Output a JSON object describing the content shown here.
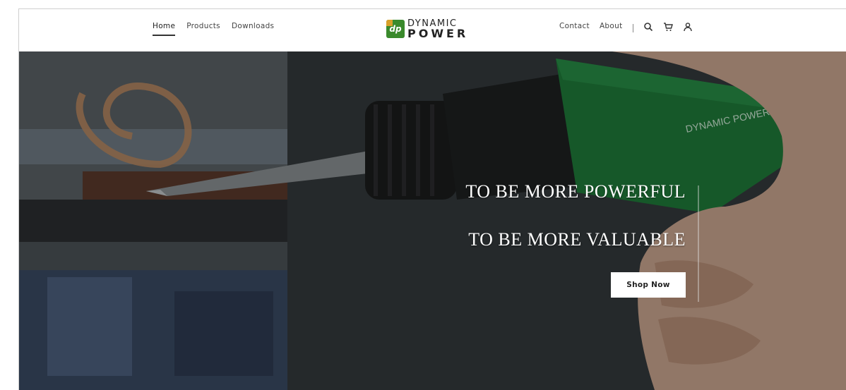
{
  "nav": {
    "left": [
      {
        "label": "Home",
        "active": true
      },
      {
        "label": "Products",
        "active": false
      },
      {
        "label": "Downloads",
        "active": false
      }
    ],
    "right": [
      {
        "label": "Contact"
      },
      {
        "label": "About"
      }
    ],
    "icons": [
      "search-icon",
      "cart-icon",
      "user-icon"
    ]
  },
  "logo": {
    "mark": "dp",
    "top": "DYNAMIC",
    "bottom": "POWER",
    "colors": {
      "green": "#3a8a2c",
      "gold": "#d8a02a"
    }
  },
  "hero": {
    "line1": "TO BE MORE POWERFUL",
    "line2": "TO BE MORE VALUABLE",
    "button": "Shop Now",
    "tool_brand": "DYNAMIC POWER",
    "tool_color": "#1f7a3a"
  }
}
